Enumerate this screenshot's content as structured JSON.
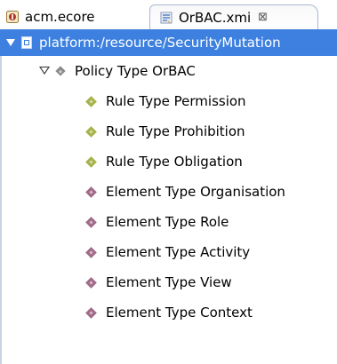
{
  "tabs": [
    {
      "label": "acm.ecore",
      "icon": "ecore-package-icon",
      "active": false
    },
    {
      "label": "OrBAC.xmi",
      "icon": "xmi-model-icon",
      "active": true,
      "close_glyph": "⊠"
    }
  ],
  "tree": {
    "resource": {
      "label": "platform:/resource/SecurityMutation"
    },
    "policy": {
      "label": "Policy Type OrBAC"
    },
    "children": [
      {
        "label": "Rule Type Permission",
        "kind": "rule"
      },
      {
        "label": "Rule Type Prohibition",
        "kind": "rule"
      },
      {
        "label": "Rule Type Obligation",
        "kind": "rule"
      },
      {
        "label": "Element Type Organisation",
        "kind": "element"
      },
      {
        "label": "Element Type Role",
        "kind": "element"
      },
      {
        "label": "Element Type Activity",
        "kind": "element"
      },
      {
        "label": "Element Type View",
        "kind": "element"
      },
      {
        "label": "Element Type Context",
        "kind": "element"
      }
    ]
  },
  "colors": {
    "selection": "#3d80df",
    "rule_icon": "#a7b24a",
    "element_icon": "#a06a88",
    "policy_icon": "#8a8a8a"
  }
}
